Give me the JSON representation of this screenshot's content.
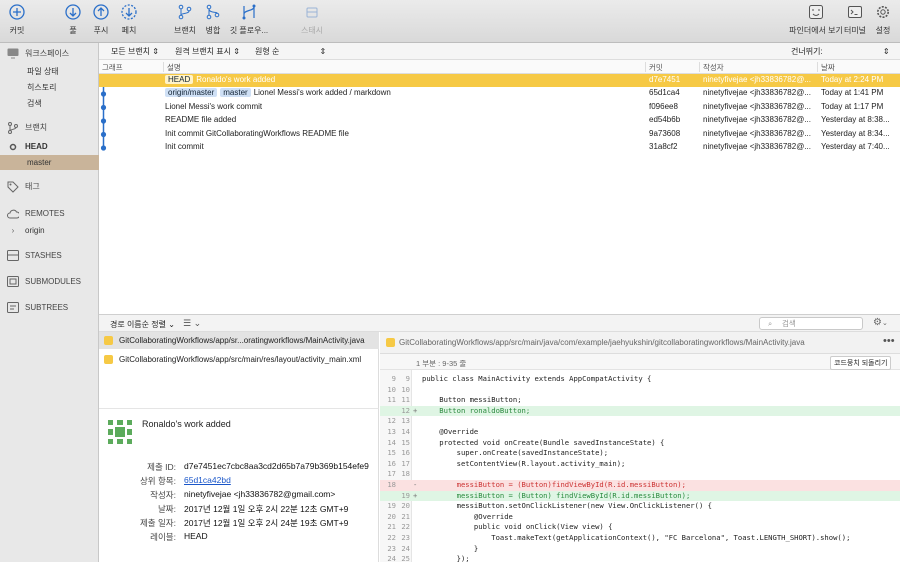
{
  "toolbar": {
    "commit": "커밋",
    "pull": "풀",
    "push": "푸시",
    "fetch": "페치",
    "branch": "브랜치",
    "merge": "병합",
    "gitflow": "깃 플로우...",
    "stash": "스태시",
    "finder": "파인더에서 보기",
    "terminal": "터미널",
    "settings": "설정"
  },
  "sidebar": {
    "workspace": "워크스페이스",
    "file_status": "파일 상태",
    "history": "히스토리",
    "search": "검색",
    "branches": "브랜치",
    "head": "HEAD",
    "master": "master",
    "tags": "태그",
    "remotes": "REMOTES",
    "origin": "origin",
    "stashes": "STASHES",
    "submodules": "SUBMODULES",
    "subtrees": "SUBTREES"
  },
  "filters": {
    "all_branches": "모든 브랜치",
    "show_remote": "원격 브랜치 표시",
    "order": "원형 순",
    "jump_to": "건너뛰기:"
  },
  "columns": {
    "graph": "그래프",
    "desc": "설명",
    "commit": "커밋",
    "author": "작성자",
    "date": "날짜"
  },
  "commits": [
    {
      "tags": [
        "HEAD"
      ],
      "msg": "Ronaldo's work added",
      "hash": "d7e7451",
      "author": "ninetyfivejae <jh33836782@...",
      "date": "Today at 2:24 PM"
    },
    {
      "tags": [
        "origin/master",
        "master"
      ],
      "msg": "Lionel Messi's work added / markdown",
      "hash": "65d1ca4",
      "author": "ninetyfivejae <jh33836782@...",
      "date": "Today at 1:41 PM"
    },
    {
      "tags": [],
      "msg": "Lionel Messi's work commit",
      "hash": "f096ee8",
      "author": "ninetyfivejae <jh33836782@...",
      "date": "Today at 1:17 PM"
    },
    {
      "tags": [],
      "msg": "README file added",
      "hash": "ed54b6b",
      "author": "ninetyfivejae <jh33836782@...",
      "date": "Yesterday at 8:38..."
    },
    {
      "tags": [],
      "msg": "Init commit GitCollaboratingWorkflows README file",
      "hash": "9a73608",
      "author": "ninetyfivejae <jh33836782@...",
      "date": "Yesterday at 8:34..."
    },
    {
      "tags": [],
      "msg": "Init commit",
      "hash": "31a8cf2",
      "author": "ninetyfivejae <jh33836782@...",
      "date": "Yesterday at 7:40..."
    }
  ],
  "midbar": {
    "sort": "경로 이름순 정렬",
    "search_placeholder": "검색"
  },
  "files": [
    "GitCollaboratingWorkflows/app/sr...oratingworkflows/MainActivity.java",
    "GitCollaboratingWorkflows/app/src/main/res/layout/activity_main.xml"
  ],
  "details": {
    "summary": "Ronaldo's work added",
    "commit_id_label": "제출 ID:",
    "commit_id": "d7e7451ec7cbc8aa3cd2d65b7a79b369b154efe9",
    "parent_label": "상위 항목:",
    "parent": "65d1ca42bd",
    "author_label": "작성자:",
    "author": "ninetyfivejae <jh33836782@gmail.com>",
    "date_label": "날짜:",
    "date": "2017년 12월 1일 오후 2시 22분 12초 GMT+9",
    "commit_date_label": "제출 일자:",
    "commit_date": "2017년 12월 1일 오후 2시 24분 19초 GMT+9",
    "labels_label": "레이블:",
    "labels": "HEAD"
  },
  "diff": {
    "path": "GitCollaboratingWorkflows/app/src/main/java/com/example/jaehyukshin/gitcollaboratingworkflows/MainActivity.java",
    "hunk": "1 부분 : 9-35 줄",
    "revert": "코드뭉치 되돌리기",
    "lines": [
      {
        "a": "9",
        "b": "9",
        "t": "ctx",
        "s": "",
        "x": "public class MainActivity extends AppCompatActivity {"
      },
      {
        "a": "10",
        "b": "10",
        "t": "ctx",
        "s": "",
        "x": ""
      },
      {
        "a": "11",
        "b": "11",
        "t": "ctx",
        "s": "",
        "x": "    Button messiButton;"
      },
      {
        "a": "",
        "b": "12",
        "t": "add",
        "s": "+",
        "x": "    Button ronaldoButton;"
      },
      {
        "a": "12",
        "b": "13",
        "t": "ctx",
        "s": "",
        "x": ""
      },
      {
        "a": "13",
        "b": "14",
        "t": "ctx",
        "s": "",
        "x": "    @Override"
      },
      {
        "a": "14",
        "b": "15",
        "t": "ctx",
        "s": "",
        "x": "    protected void onCreate(Bundle savedInstanceState) {"
      },
      {
        "a": "15",
        "b": "16",
        "t": "ctx",
        "s": "",
        "x": "        super.onCreate(savedInstanceState);"
      },
      {
        "a": "16",
        "b": "17",
        "t": "ctx",
        "s": "",
        "x": "        setContentView(R.layout.activity_main);"
      },
      {
        "a": "17",
        "b": "18",
        "t": "ctx",
        "s": "",
        "x": ""
      },
      {
        "a": "18",
        "b": "",
        "t": "del",
        "s": "-",
        "x": "        messiButton = (Button)findViewById(R.id.messiButton);"
      },
      {
        "a": "",
        "b": "19",
        "t": "add",
        "s": "+",
        "x": "        messiButton = (Button) findViewById(R.id.messiButton);"
      },
      {
        "a": "19",
        "b": "20",
        "t": "ctx",
        "s": "",
        "x": "        messiButton.setOnClickListener(new View.OnClickListener() {"
      },
      {
        "a": "20",
        "b": "21",
        "t": "ctx",
        "s": "",
        "x": "            @Override"
      },
      {
        "a": "21",
        "b": "22",
        "t": "ctx",
        "s": "",
        "x": "            public void onClick(View view) {"
      },
      {
        "a": "22",
        "b": "23",
        "t": "ctx",
        "s": "",
        "x": "                Toast.makeText(getApplicationContext(), \"FC Barcelona\", Toast.LENGTH_SHORT).show();"
      },
      {
        "a": "23",
        "b": "24",
        "t": "ctx",
        "s": "",
        "x": "            }"
      },
      {
        "a": "24",
        "b": "25",
        "t": "ctx",
        "s": "",
        "x": "        });"
      }
    ]
  },
  "colors": {
    "selected_row": "#f6c945",
    "accent_blue": "#2a6fc9",
    "added": "#dff5e4",
    "removed": "#fbe1e1"
  }
}
